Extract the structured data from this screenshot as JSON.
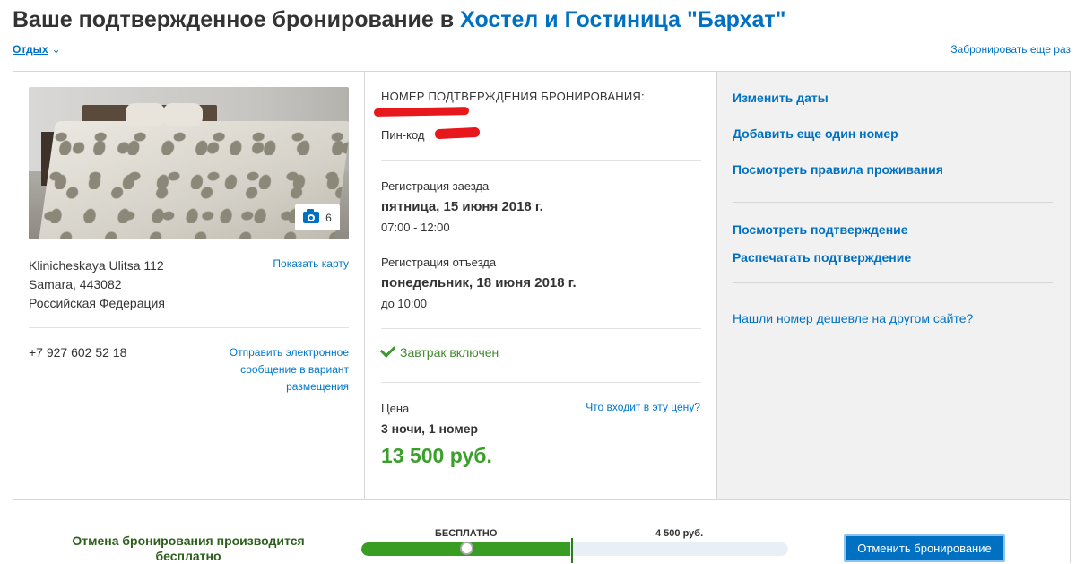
{
  "header": {
    "title_prefix": "Ваше подтвержденное бронирование в",
    "hotel_name": "Хостел и Гостиница \"Бархат\"",
    "trip_dropdown": "Отдых",
    "book_again": "Забронировать еще раз"
  },
  "property": {
    "photo_count": "6",
    "address_line1": "Klinicheskaya Ulitsa 112",
    "address_line2": "Samara, 443082",
    "address_line3": "Российская Федерация",
    "show_map": "Показать карту",
    "phone": "+7 927 602 52 18",
    "send_message": "Отправить электронное сообщение в вариант размещения"
  },
  "booking": {
    "confirmation_label": "НОМЕР ПОДТВЕРЖДЕНИЯ БРОНИРОВАНИЯ:",
    "pin_label": "Пин-код",
    "checkin_label": "Регистрация заезда",
    "checkin_date": "пятница, 15 июня 2018 г.",
    "checkin_time": "07:00 - 12:00",
    "checkout_label": "Регистрация отъезда",
    "checkout_date": "понедельник, 18 июня 2018 г.",
    "checkout_time": "до 10:00",
    "breakfast": "Завтрак включен",
    "price_label": "Цена",
    "price_included_link": "Что входит в эту цену?",
    "nights_rooms": "3 ночи, 1 номер",
    "price": "13 500 руб."
  },
  "actions": {
    "change_dates": "Изменить даты",
    "add_room": "Добавить еще один номер",
    "house_rules": "Посмотреть правила проживания",
    "view_confirmation": "Посмотреть подтверждение",
    "print_confirmation": "Распечатать подтверждение",
    "found_cheaper": "Нашли номер дешевле на другом сайте?"
  },
  "cancellation": {
    "note": "Отмена бронирования производится бесплатно",
    "free_label": "БЕСПЛАТНО",
    "fee_label": "4 500 руб.",
    "free_fraction": 0.49,
    "cancel_button": "Отменить бронирование"
  },
  "colors": {
    "link": "#0071c2",
    "price_green": "#3b9f2b",
    "redaction": "#e8171b"
  }
}
